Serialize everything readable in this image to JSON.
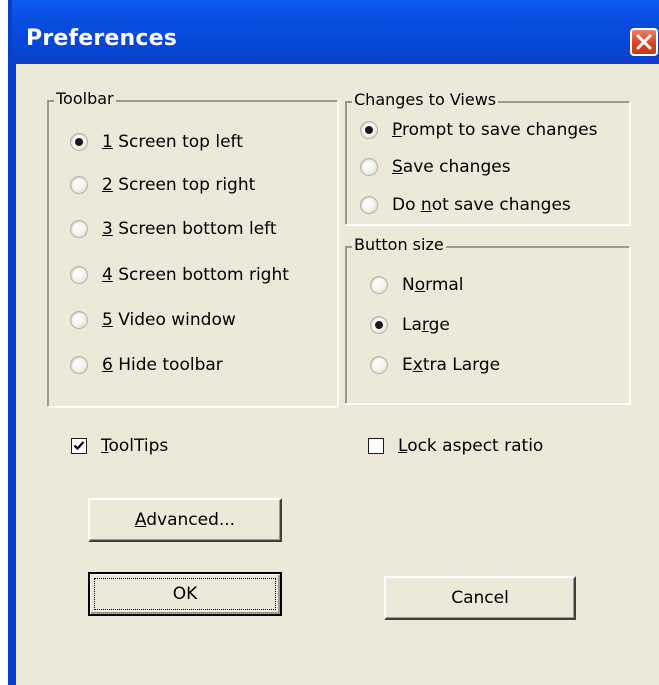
{
  "window": {
    "title": "Preferences",
    "colors": {
      "titlebar": "#0a4fe0",
      "face": "#ece9d8",
      "close": "#d7441f"
    },
    "close_icon": "close-icon"
  },
  "toolbar_group": {
    "legend": "Toolbar",
    "options": [
      {
        "hotkey": "1",
        "rest": " Screen top left",
        "checked": true
      },
      {
        "hotkey": "2",
        "rest": " Screen top right",
        "checked": false
      },
      {
        "hotkey": "3",
        "rest": " Screen bottom left",
        "checked": false
      },
      {
        "hotkey": "4",
        "rest": " Screen bottom right",
        "checked": false
      },
      {
        "hotkey": "5",
        "rest": " Video window",
        "checked": false
      },
      {
        "hotkey": "6",
        "rest": " Hide toolbar",
        "checked": false
      }
    ]
  },
  "views_group": {
    "legend": "Changes to Views",
    "options": [
      {
        "pre": "",
        "hotkey": "P",
        "post": "rompt to save changes",
        "checked": true
      },
      {
        "pre": "",
        "hotkey": "S",
        "post": "ave changes",
        "checked": false
      },
      {
        "pre": "Do ",
        "hotkey": "n",
        "post": "ot save changes",
        "checked": false
      }
    ]
  },
  "button_size_group": {
    "legend": "Button size",
    "options": [
      {
        "pre": "N",
        "hotkey": "o",
        "post": "rmal",
        "checked": false
      },
      {
        "pre": "La",
        "hotkey": "r",
        "post": "ge",
        "checked": true
      },
      {
        "pre": "E",
        "hotkey": "x",
        "post": "tra Large",
        "checked": false
      }
    ]
  },
  "checkboxes": {
    "tooltips": {
      "hotkey": "T",
      "post": "oolTips",
      "checked": true
    },
    "lock_aspect": {
      "hotkey": "L",
      "post": "ock aspect ratio",
      "checked": false
    }
  },
  "buttons": {
    "advanced": {
      "hotkey": "A",
      "post": "dvanced..."
    },
    "ok": "OK",
    "cancel": "Cancel"
  }
}
